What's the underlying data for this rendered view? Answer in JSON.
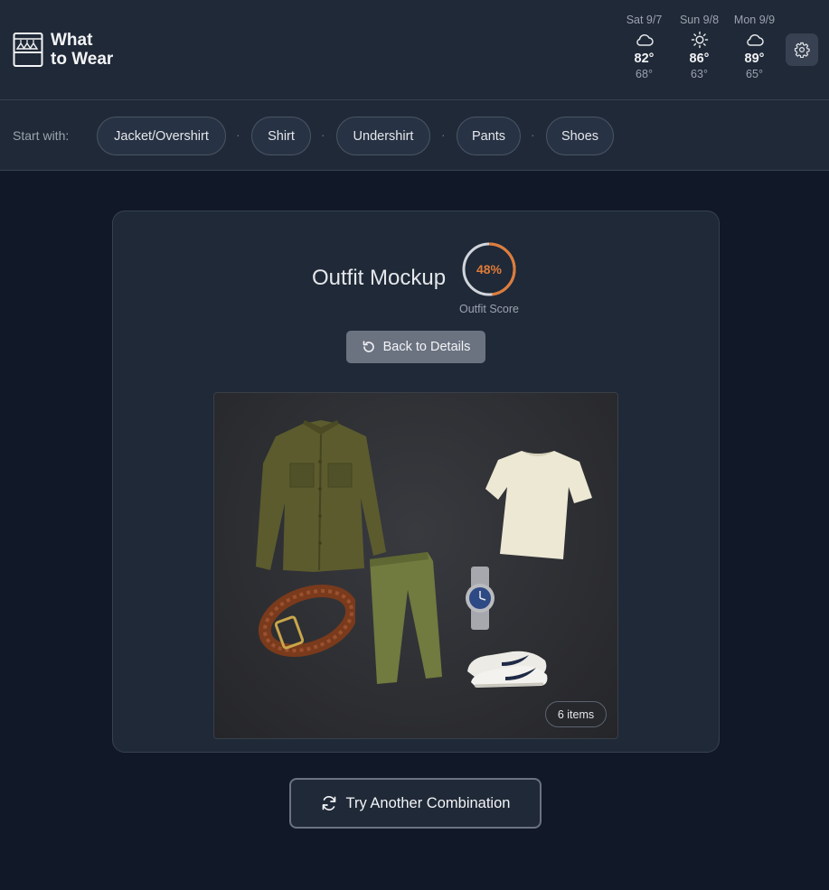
{
  "app": {
    "title_line1": "What",
    "title_line2": "to Wear",
    "logo_icon": "wardrobe-icon"
  },
  "weather": [
    {
      "day": "Sat 9/7",
      "icon": "cloud-icon",
      "high": "82°",
      "low": "68°"
    },
    {
      "day": "Sun 9/8",
      "icon": "sun-icon",
      "high": "86°",
      "low": "63°"
    },
    {
      "day": "Mon 9/9",
      "icon": "cloud-icon",
      "high": "89°",
      "low": "65°"
    }
  ],
  "settings": {
    "icon": "gear-icon"
  },
  "start_bar": {
    "label": "Start with:",
    "separator": "·",
    "chips": [
      "Jacket/Overshirt",
      "Shirt",
      "Undershirt",
      "Pants",
      "Shoes"
    ]
  },
  "mockup": {
    "title": "Outfit Mockup",
    "score_text": "48%",
    "score_value": 0.48,
    "score_label": "Outfit Score",
    "back_button": "Back to Details",
    "items_badge": "6 items",
    "items": [
      "olive overshirt jacket",
      "cream t-shirt",
      "brown braided belt",
      "olive chino pants",
      "silver dive watch",
      "white sneakers"
    ]
  },
  "try_button": "Try Another Combination",
  "colors": {
    "background": "#111827",
    "panel": "#1f2937",
    "accent_score": "#e07b39",
    "border": "#374151"
  }
}
